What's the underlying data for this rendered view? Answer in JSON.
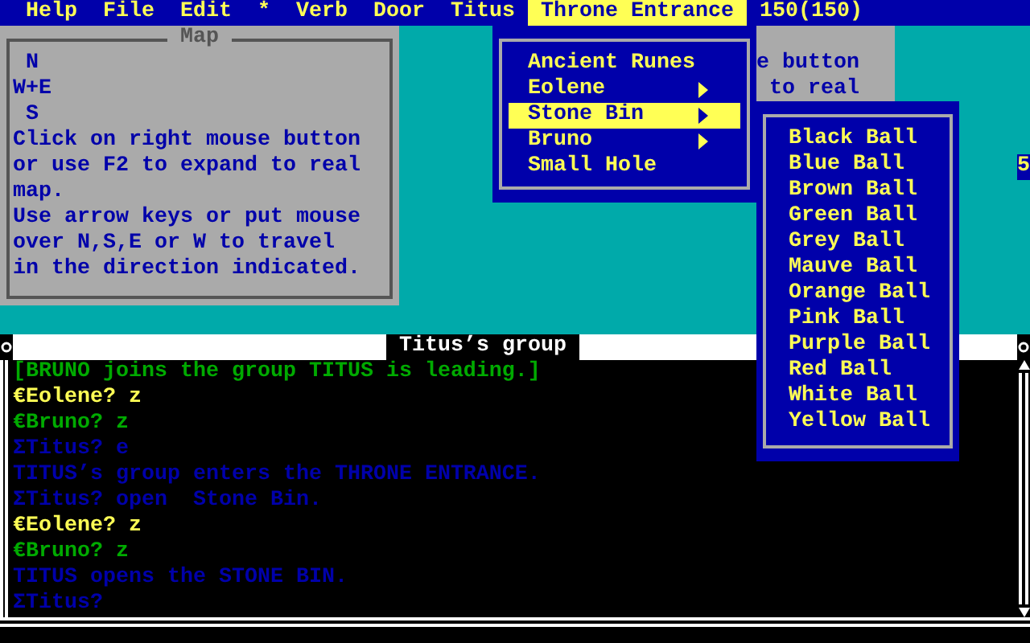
{
  "menubar": [
    {
      "label": "Help",
      "selected": false
    },
    {
      "label": "File",
      "selected": false
    },
    {
      "label": "Edit",
      "selected": false
    },
    {
      "label": "*",
      "selected": false
    },
    {
      "label": "Verb",
      "selected": false
    },
    {
      "label": "Door",
      "selected": false
    },
    {
      "label": "Titus",
      "selected": false
    },
    {
      "label": "Throne Entrance",
      "selected": true
    },
    {
      "label": "150(150)",
      "selected": false
    }
  ],
  "map_window": {
    "title": "Map",
    "lines": [
      " N",
      "W+E",
      " S",
      "Click on right mouse button",
      "or use F2 to expand to real",
      "map.",
      "Use arrow keys or put mouse",
      "over N,S,E or W to travel",
      "in the direction indicated."
    ]
  },
  "back_window": {
    "lines": [
      "e button",
      "to real"
    ]
  },
  "edge_text": "5",
  "menu": [
    {
      "label": "Ancient Runes",
      "selected": false,
      "has_submenu": false
    },
    {
      "label": "Eolene",
      "selected": false,
      "has_submenu": true
    },
    {
      "label": "Stone Bin",
      "selected": true,
      "has_submenu": true
    },
    {
      "label": "Bruno",
      "selected": false,
      "has_submenu": true
    },
    {
      "label": "Small Hole",
      "selected": false,
      "has_submenu": false
    }
  ],
  "submenu": [
    "Black Ball",
    "Blue Ball",
    "Brown Ball",
    "Green Ball",
    "Grey Ball",
    "Mauve Ball",
    "Orange Ball",
    "Pink Ball",
    "Purple Ball",
    "Red Ball",
    "White Ball",
    "Yellow Ball"
  ],
  "console": {
    "title": "Titus’s group",
    "lines": [
      {
        "text": "[BRUNO joins the group TITUS is leading.]",
        "color": "#00aa00"
      },
      {
        "text": "€Eolene? z",
        "color": "#ffff55"
      },
      {
        "text": "€Bruno? z",
        "color": "#00aa00"
      },
      {
        "text": "ΣTitus? e",
        "color": "#0000aa"
      },
      {
        "text": "TITUS’s group enters the THRONE ENTRANCE.",
        "color": "#0000aa"
      },
      {
        "text": "ΣTitus? open  Stone Bin.",
        "color": "#0000aa"
      },
      {
        "text": "€Eolene? z",
        "color": "#ffff55"
      },
      {
        "text": "€Bruno? z",
        "color": "#00aa00"
      },
      {
        "text": "TITUS opens the STONE BIN.",
        "color": "#0000aa"
      },
      {
        "text": "ΣTitus?",
        "color": "#0000aa"
      }
    ]
  }
}
